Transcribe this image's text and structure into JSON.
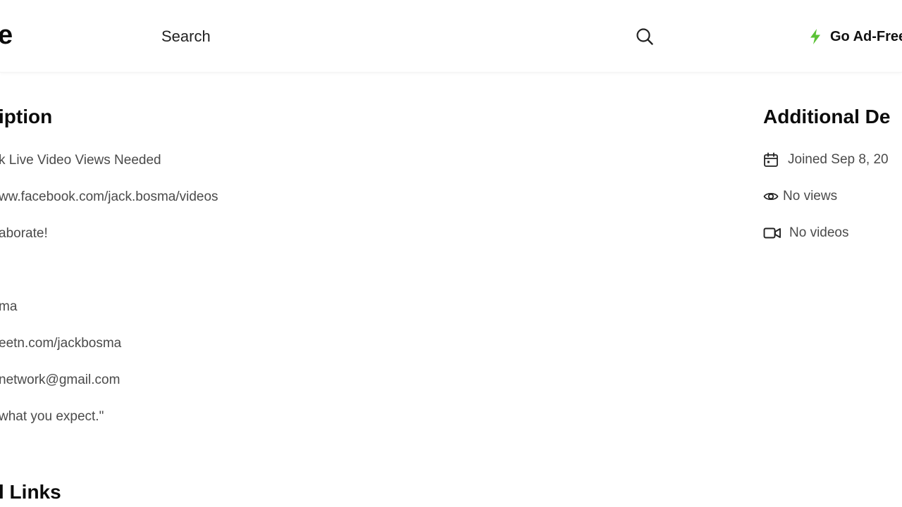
{
  "header": {
    "logo_fragment": "e",
    "search": {
      "placeholder": "Search",
      "value": ""
    },
    "ad_free_label": "Go Ad-Free",
    "accent_color": "#5bc236"
  },
  "description": {
    "title": "iption",
    "lines": [
      "k Live Video Views Needed",
      "ww.facebook.com/jack.bosma/videos",
      "aborate!",
      "ma",
      "eetn.com/jackbosma",
      "network@gmail.com",
      "what you expect.\""
    ]
  },
  "links": {
    "title": "l Links"
  },
  "details": {
    "title": "Additional De",
    "joined": "Joined Sep 8, 20",
    "views": "No views",
    "videos": "No videos"
  },
  "icons": {
    "search": "search-icon",
    "bolt": "lightning-bolt-icon",
    "calendar": "calendar-icon",
    "eye": "eye-icon",
    "video": "video-camera-icon"
  }
}
